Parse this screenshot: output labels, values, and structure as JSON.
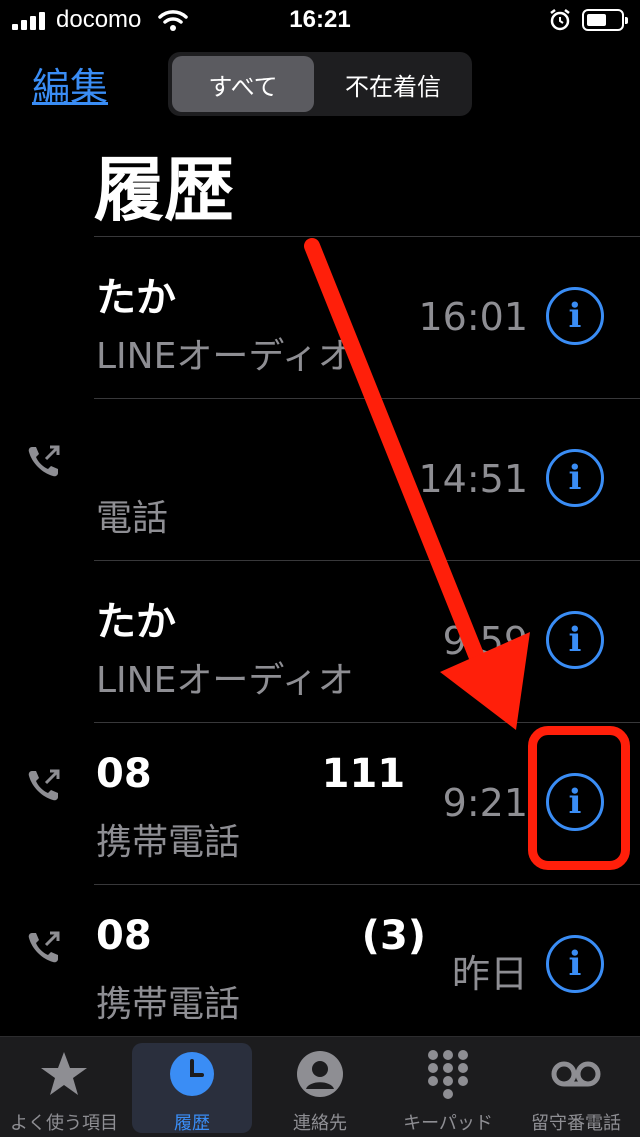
{
  "status_bar": {
    "carrier": "docomo",
    "time": "16:21"
  },
  "nav": {
    "edit_label": "編集",
    "segments": [
      "すべて",
      "不在着信"
    ],
    "selected_segment": "すべて"
  },
  "title": "履歴",
  "calls": [
    {
      "name": "たか",
      "type": "LINEオーディオ",
      "time": "16:01",
      "outgoing": false
    },
    {
      "name": "",
      "type": "電話",
      "time": "14:51",
      "outgoing": true
    },
    {
      "name": "たか",
      "type": "LINEオーディオ",
      "time": "9:59",
      "outgoing": false
    },
    {
      "name": "08",
      "name_suffix": "111",
      "type": "携帯電話",
      "time": "9:21",
      "outgoing": true
    },
    {
      "name": "08",
      "name_suffix": "(3)",
      "type": "携帯電話",
      "time": "昨日",
      "outgoing": true
    }
  ],
  "tabs": [
    {
      "label": "よく使う項目",
      "icon": "star-icon"
    },
    {
      "label": "履歴",
      "icon": "clock-icon",
      "active": true
    },
    {
      "label": "連絡先",
      "icon": "person-icon"
    },
    {
      "label": "キーパッド",
      "icon": "keypad-icon"
    },
    {
      "label": "留守番電話",
      "icon": "voicemail-icon"
    }
  ],
  "colors": {
    "accent": "#3a8df5",
    "annotation": "#ff1f0a",
    "secondary_text": "#8e8e93"
  }
}
